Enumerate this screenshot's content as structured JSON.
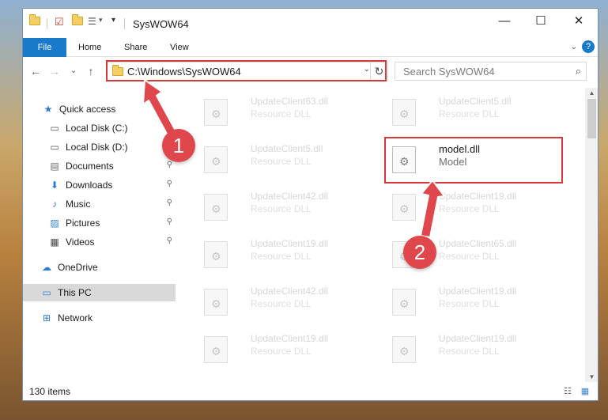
{
  "window": {
    "title": "SysWOW64",
    "controls": {
      "minimize": "—",
      "maximize": "☐",
      "close": "✕"
    }
  },
  "quick_access_toolbar": {
    "dropdown": "▾"
  },
  "ribbon": {
    "tabs": [
      "File",
      "Home",
      "Share",
      "View"
    ],
    "expand": "⌄",
    "help": "?"
  },
  "navigation": {
    "back": "←",
    "forward": "→",
    "recent": "⌄",
    "up": "↑",
    "address": "C:\\Windows\\SysWOW64",
    "address_dropdown": "⌄",
    "refresh": "↻",
    "search_placeholder": "Search SysWOW64"
  },
  "sidebar": {
    "items": [
      {
        "label": "Quick access",
        "icon": "star-icon",
        "glyph": "★",
        "color": "#2b79d1",
        "pinned": false
      },
      {
        "label": "Local Disk (C:)",
        "icon": "drive-icon",
        "glyph": "▭",
        "color": "#555555",
        "pinned": true
      },
      {
        "label": "Local Disk (D:)",
        "icon": "drive-icon",
        "glyph": "▭",
        "color": "#555555",
        "pinned": true
      },
      {
        "label": "Documents",
        "icon": "document-icon",
        "glyph": "▤",
        "color": "#6a6a6a",
        "pinned": true
      },
      {
        "label": "Downloads",
        "icon": "download-icon",
        "glyph": "⬇",
        "color": "#2b79d1",
        "pinned": true
      },
      {
        "label": "Music",
        "icon": "music-icon",
        "glyph": "♪",
        "color": "#2b79d1",
        "pinned": true
      },
      {
        "label": "Pictures",
        "icon": "picture-icon",
        "glyph": "▨",
        "color": "#3c82c8",
        "pinned": true
      },
      {
        "label": "Videos",
        "icon": "video-icon",
        "glyph": "▦",
        "color": "#444444",
        "pinned": true
      },
      {
        "label": "OneDrive",
        "icon": "cloud-icon",
        "glyph": "☁",
        "color": "#2b79d1",
        "pinned": false
      },
      {
        "label": "This PC",
        "icon": "computer-icon",
        "glyph": "▭",
        "color": "#3c82c8",
        "pinned": false,
        "selected": true
      },
      {
        "label": "Network",
        "icon": "network-icon",
        "glyph": "⊞",
        "color": "#2b79d1",
        "pinned": false
      }
    ],
    "pin_glyph": "📌"
  },
  "files": [
    {
      "name": "UpdateClient63.dll",
      "type": "Resource DLL"
    },
    {
      "name": "UpdateClient5.dll",
      "type": "Resource DLL"
    },
    {
      "name": "UpdateClient5.dll",
      "type": "Resource DLL"
    },
    {
      "name": "model.dll",
      "type": "Model",
      "highlighted": true
    },
    {
      "name": "UpdateClient42.dll",
      "type": "Resource DLL"
    },
    {
      "name": "UpdateClient19.dll",
      "type": "Resource DLL"
    },
    {
      "name": "UpdateClient19.dll",
      "type": "Resource DLL"
    },
    {
      "name": "UpdateClient65.dll",
      "type": "Resource DLL"
    },
    {
      "name": "UpdateClient42.dll",
      "type": "Resource DLL"
    },
    {
      "name": "UpdateClient19.dll",
      "type": "Resource DLL"
    },
    {
      "name": "UpdateClient19.dll",
      "type": "Resource DLL"
    },
    {
      "name": "UpdateClient19.dll",
      "type": "Resource DLL"
    }
  ],
  "scrollbar": {
    "up": "▲",
    "down": "▼"
  },
  "status": {
    "item_count": "130 items",
    "details_view": "☷",
    "tiles_view": "▦"
  },
  "annotations": {
    "badge1": "1",
    "badge2": "2",
    "highlight_color": "#d33b3b",
    "arrow_color": "#e0474c"
  }
}
